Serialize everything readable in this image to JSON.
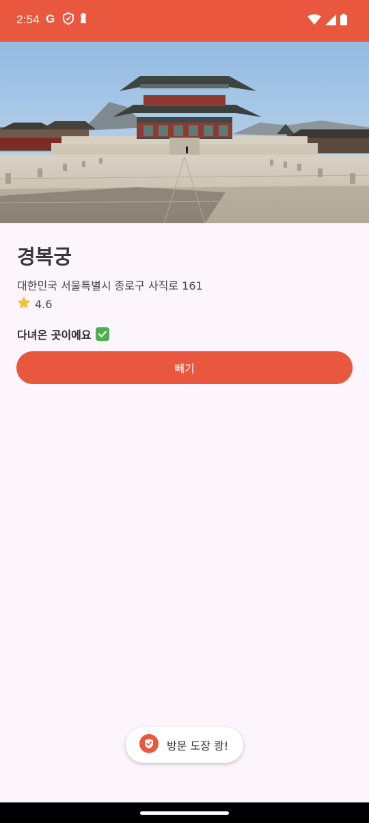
{
  "status_bar": {
    "time": "2:54",
    "icons_left": [
      "google-icon",
      "shield-icon",
      "keyhole-icon"
    ],
    "icons_right": [
      "wifi-icon",
      "cellular-signal-icon",
      "battery-icon"
    ]
  },
  "place": {
    "name": "경복궁",
    "address": "대한민국 서울특별시 종로구 사직로 161",
    "rating": "4.6",
    "rating_icon": "star-icon",
    "visited_label": "다녀온 곳이에요",
    "visited_icon": "check-mark-icon"
  },
  "action": {
    "button_label": "빼기"
  },
  "toast": {
    "icon": "stamp-check-icon",
    "message": "방문 도장 쾅!"
  },
  "colors": {
    "accent": "#E8573E",
    "background": "#FCF5FC",
    "check_green": "#4CAF50"
  }
}
